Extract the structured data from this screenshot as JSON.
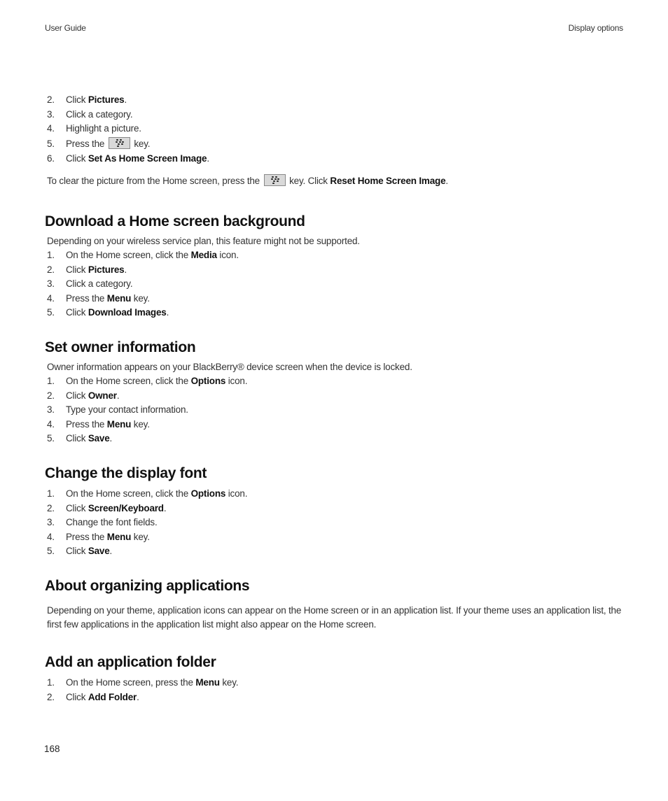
{
  "header": {
    "left": "User Guide",
    "right": "Display options"
  },
  "continued_steps": {
    "items": [
      {
        "num": "2.",
        "pre": "Click ",
        "bold": "Pictures",
        "post": "."
      },
      {
        "num": "3.",
        "pre": "Click a category.",
        "bold": "",
        "post": ""
      },
      {
        "num": "4.",
        "pre": "Highlight a picture.",
        "bold": "",
        "post": ""
      },
      {
        "num": "5.",
        "pre": "Press the ",
        "key": "blackberry-menu-key",
        "post": " key."
      },
      {
        "num": "6.",
        "pre": "Click ",
        "bold": "Set As Home Screen Image",
        "post": "."
      }
    ],
    "note": {
      "pre": "To clear the picture from the Home screen, press the ",
      "key": "blackberry-menu-key",
      "mid": " key. Click ",
      "bold": "Reset Home Screen Image",
      "post": "."
    }
  },
  "sections": [
    {
      "title": "Download a Home screen background",
      "intro": "Depending on your wireless service plan, this feature might not be supported.",
      "steps": [
        {
          "num": "1.",
          "pre": "On the Home screen, click the ",
          "bold": "Media",
          "post": " icon."
        },
        {
          "num": "2.",
          "pre": "Click ",
          "bold": "Pictures",
          "post": "."
        },
        {
          "num": "3.",
          "pre": "Click a category.",
          "bold": "",
          "post": ""
        },
        {
          "num": "4.",
          "pre": "Press the ",
          "bold": "Menu",
          "post": " key."
        },
        {
          "num": "5.",
          "pre": "Click ",
          "bold": "Download Images",
          "post": "."
        }
      ]
    },
    {
      "title": "Set owner information",
      "intro": "Owner information appears on your BlackBerry® device screen when the device is locked.",
      "steps": [
        {
          "num": "1.",
          "pre": "On the Home screen, click the ",
          "bold": "Options",
          "post": " icon."
        },
        {
          "num": "2.",
          "pre": "Click ",
          "bold": "Owner",
          "post": "."
        },
        {
          "num": "3.",
          "pre": "Type your contact information.",
          "bold": "",
          "post": ""
        },
        {
          "num": "4.",
          "pre": "Press the ",
          "bold": "Menu",
          "post": " key."
        },
        {
          "num": "5.",
          "pre": "Click ",
          "bold": "Save",
          "post": "."
        }
      ]
    },
    {
      "title": "Change the display font",
      "steps": [
        {
          "num": "1.",
          "pre": "On the Home screen, click the ",
          "bold": "Options",
          "post": " icon."
        },
        {
          "num": "2.",
          "pre": "Click ",
          "bold": "Screen/Keyboard",
          "post": "."
        },
        {
          "num": "3.",
          "pre": "Change the font fields.",
          "bold": "",
          "post": ""
        },
        {
          "num": "4.",
          "pre": "Press the ",
          "bold": "Menu",
          "post": " key."
        },
        {
          "num": "5.",
          "pre": "Click ",
          "bold": "Save",
          "post": "."
        }
      ]
    },
    {
      "title": "About organizing applications",
      "paragraph": "Depending on your theme, application icons can appear on the Home screen or in an application list. If your theme uses an application list, the first few applications in the application list might also appear on the Home screen."
    },
    {
      "title": "Add an application folder",
      "steps": [
        {
          "num": "1.",
          "pre": "On the Home screen, press the ",
          "bold": "Menu",
          "post": " key."
        },
        {
          "num": "2.",
          "pre": "Click ",
          "bold": "Add Folder",
          "post": "."
        }
      ]
    }
  ],
  "footer": {
    "page_number": "168"
  }
}
